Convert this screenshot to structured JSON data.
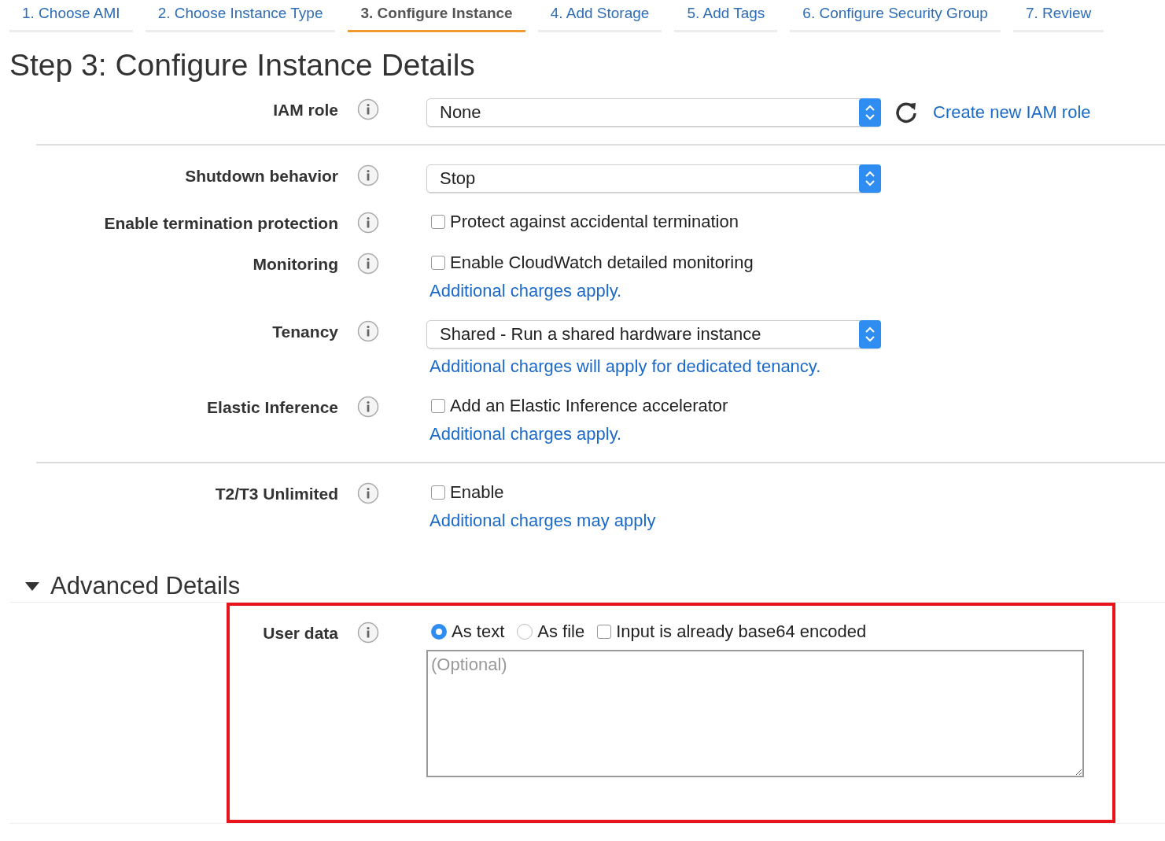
{
  "tabs": [
    {
      "label": "1. Choose AMI",
      "selected": false
    },
    {
      "label": "2. Choose Instance Type",
      "selected": false
    },
    {
      "label": "3. Configure Instance",
      "selected": true
    },
    {
      "label": "4. Add Storage",
      "selected": false
    },
    {
      "label": "5. Add Tags",
      "selected": false
    },
    {
      "label": "6. Configure Security Group",
      "selected": false
    },
    {
      "label": "7. Review",
      "selected": false
    }
  ],
  "title": "Step 3: Configure Instance Details",
  "sections": [
    {
      "rows": [
        {
          "label": "IAM role",
          "kind": "select",
          "value": "None",
          "action_link": "Create new IAM role"
        }
      ]
    },
    {
      "rows": [
        {
          "label": "Shutdown behavior",
          "kind": "select",
          "value": "Stop"
        },
        {
          "label": "Enable termination protection",
          "kind": "checkbox",
          "option": "Protect against accidental termination",
          "checked": false
        },
        {
          "label": "Monitoring",
          "kind": "checkbox",
          "option": "Enable CloudWatch detailed monitoring",
          "checked": false,
          "note": "Additional charges apply."
        },
        {
          "label": "Tenancy",
          "kind": "select",
          "value": "Shared - Run a shared hardware instance",
          "note": "Additional charges will apply for dedicated tenancy."
        },
        {
          "label": "Elastic Inference",
          "kind": "checkbox",
          "option": "Add an Elastic Inference accelerator",
          "checked": false,
          "note": "Additional charges apply."
        }
      ]
    },
    {
      "rows": [
        {
          "label": "T2/T3 Unlimited",
          "kind": "checkbox",
          "option": "Enable",
          "checked": false,
          "note": "Additional charges may apply"
        }
      ]
    }
  ],
  "advanced": {
    "title": "Advanced Details",
    "expanded": true,
    "user_data": {
      "label": "User data",
      "options": [
        {
          "kind": "radio",
          "label": "As text",
          "selected": true
        },
        {
          "kind": "radio",
          "label": "As file",
          "selected": false
        },
        {
          "kind": "checkbox",
          "label": "Input is already base64 encoded",
          "checked": false
        }
      ],
      "placeholder": "(Optional)"
    }
  }
}
